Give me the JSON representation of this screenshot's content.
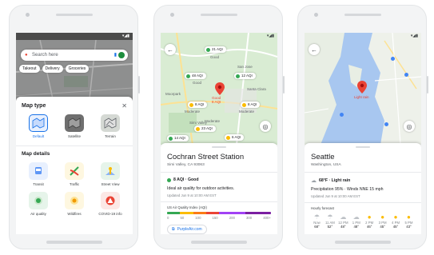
{
  "phone1": {
    "search_placeholder": "Search here",
    "chips": [
      "Takeout",
      "Delivery",
      "Groceries"
    ],
    "sheet_title": "Map type",
    "map_types": [
      {
        "label": "Default",
        "selected": true
      },
      {
        "label": "Satellite",
        "selected": false
      },
      {
        "label": "Terrain",
        "selected": false
      }
    ],
    "details_title": "Map details",
    "details": [
      {
        "label": "Transit"
      },
      {
        "label": "Traffic"
      },
      {
        "label": "Street View"
      },
      {
        "label": "Air quality"
      },
      {
        "label": "Wildfires"
      },
      {
        "label": "COVID-19 info"
      }
    ]
  },
  "phone2": {
    "aqi_pills": [
      "21 AQI",
      "48 AQI",
      "12 AQI",
      "8 AQI",
      "8 AQI",
      "23 AQI",
      "6 AQI",
      "14 AQI"
    ],
    "map_labels": [
      "Good",
      "Good",
      "Moderate",
      "Moderate",
      "Moderate",
      "Santa Clara",
      "San Jose",
      "Simi Valley",
      "Moorpark"
    ],
    "pin_label": "Good\n8 AQI",
    "station_name": "Cochran Street Station",
    "station_address": "Simi Valley, CA 93063",
    "aqi_value": "8 AQI · Good",
    "aqi_desc": "Ideal air quality for outdoor activities.",
    "updated": "Updated Jun 9 at 10:00 AM EST",
    "index_title": "US Air Quality Index (AQI)",
    "scale_ticks": [
      "0",
      "50",
      "100",
      "150",
      "200",
      "300",
      "400+"
    ],
    "link_label": "PurpleAir.com",
    "colors": {
      "good": "#34a853",
      "moderate": "#fbbc04",
      "bad": "#ea4335",
      "purple": "#8e24aa"
    }
  },
  "phone3": {
    "pin_label": "Light rain",
    "city": "Seattle",
    "region": "Washington, USA",
    "temp": "68°F · Light rain",
    "details": "Precipitation 95% · Winds NNE 15 mph",
    "updated": "Updated Jun 9 at 10:00 AM EST",
    "forecast_title": "Hourly forecast",
    "hours": [
      "Now",
      "11 AM",
      "12 PM",
      "1 PM",
      "2 PM",
      "3 PM",
      "4 PM",
      "5 PM"
    ],
    "temps": [
      "68°",
      "52°",
      "48°",
      "48°",
      "46°",
      "45°",
      "45°",
      "43°"
    ],
    "icons": [
      "rain-icon",
      "rain-icon",
      "cloud-icon",
      "cloud-icon",
      "sun-icon",
      "sun-icon",
      "sun-icon",
      "sun-icon"
    ]
  }
}
